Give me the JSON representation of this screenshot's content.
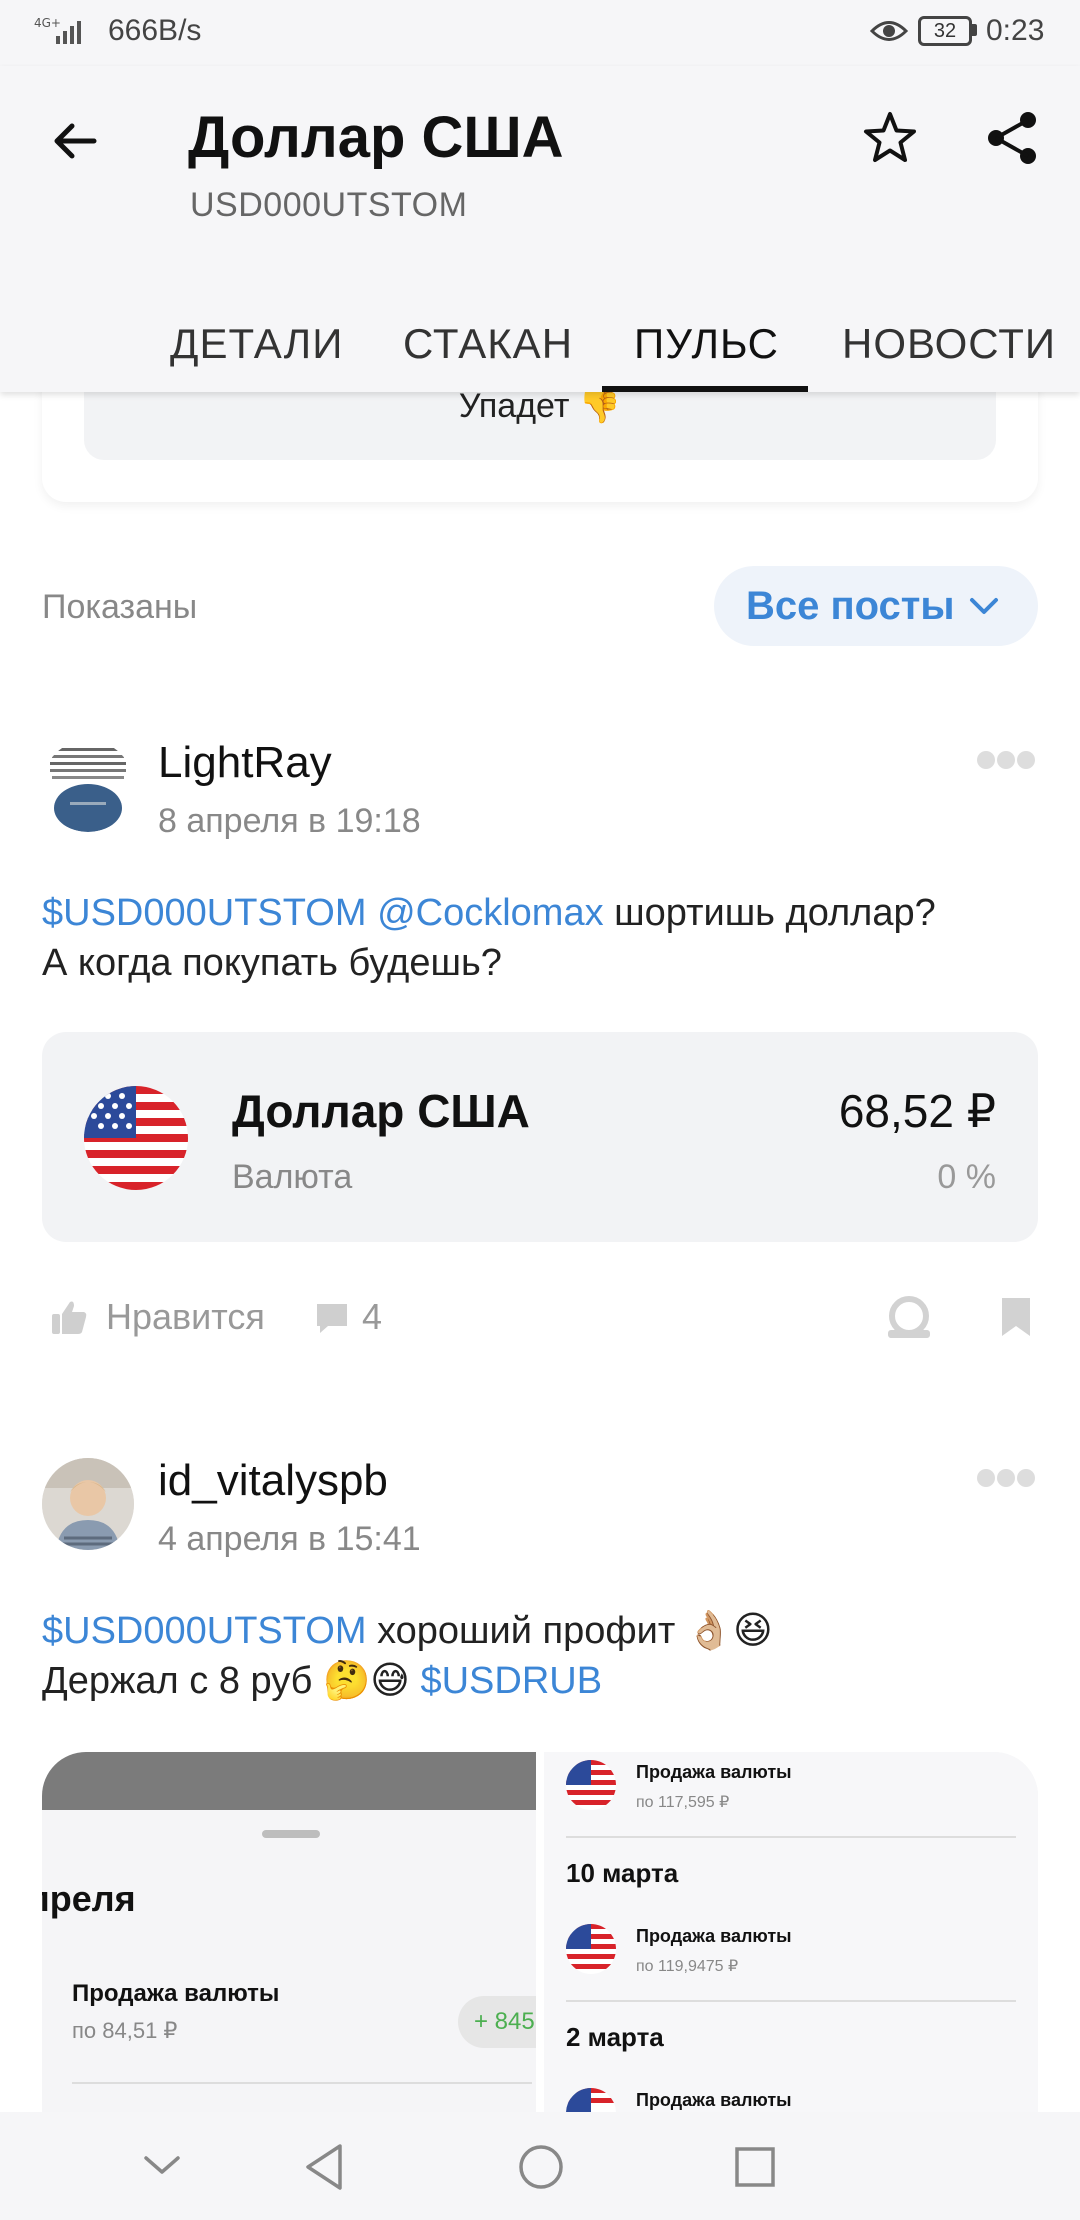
{
  "status_bar": {
    "network": "4G+",
    "speed": "666B/s",
    "battery": "32",
    "time": "0:23"
  },
  "header": {
    "title": "Доллар США",
    "subtitle": "USD000UTSTOM",
    "tabs": [
      {
        "label": "ДЕТАЛИ",
        "active": false
      },
      {
        "label": "СТАКАН",
        "active": false
      },
      {
        "label": "ПУЛЬС",
        "active": true
      },
      {
        "label": "НОВОСТИ",
        "active": false
      }
    ]
  },
  "previous_card": {
    "text": "Упадет 👎"
  },
  "filter": {
    "label": "Показаны",
    "button": "Все посты"
  },
  "posts": [
    {
      "author": "LightRay",
      "date": "8 апреля в 19:18",
      "text_parts": [
        "$USD000UTSTOM",
        " ",
        "@Cocklomax",
        " шортишь доллар?",
        "А когда покупать будешь?"
      ],
      "instrument": {
        "name": "Доллар США",
        "type": "Валюта",
        "price": "68,52 ₽",
        "change": "0 %"
      },
      "like_label": "Нравится",
      "comments": "4"
    },
    {
      "author": "id_vitalyspb",
      "date": "4 апреля в 15:41",
      "text_parts": [
        "$USD000UTSTOM",
        " хороший профит 👌🏼😆",
        "Держал с 8 руб 🤔😅 ",
        "$USDRUB"
      ],
      "image": {
        "left": {
          "month": "преля",
          "operation": "Продажа валюты",
          "rate": "по 84,51 ₽",
          "amount": "+ 845"
        },
        "right": [
          {
            "operation": "Продажа валюты",
            "rate": "по 117,595 ₽"
          },
          {
            "date": "10 марта"
          },
          {
            "operation": "Продажа валюты",
            "rate": "по 119,9475 ₽"
          },
          {
            "date": "2 марта"
          },
          {
            "operation": "Продажа валюты"
          }
        ]
      }
    }
  ],
  "colors": {
    "accent": "#3c86d6",
    "background": "#ffffff",
    "card": "#f2f3f5",
    "muted": "#888888"
  },
  "icons": [
    "back-arrow-icon",
    "star-icon",
    "share-icon",
    "chevron-down-icon",
    "more-dots-icon",
    "like-icon",
    "comment-icon",
    "repost-icon",
    "bookmark-icon",
    "usa-flag-icon"
  ]
}
